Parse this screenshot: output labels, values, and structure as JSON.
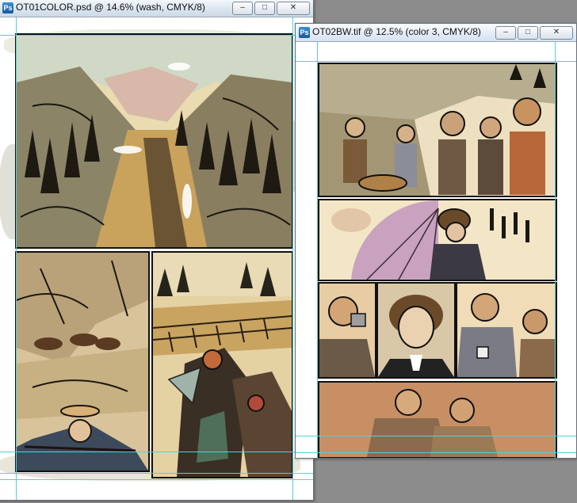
{
  "windows": [
    {
      "title": "OT01COLOR.psd @ 14.6% (wash, CMYK/8)",
      "buttons": {
        "minimize": "–",
        "maximize": "□",
        "close": "✕"
      },
      "icon": "Ps"
    },
    {
      "title": "OT02BW.tif @ 12.5% (color 3, CMYK/8)",
      "buttons": {
        "minimize": "–",
        "maximize": "□",
        "close": "✕"
      },
      "icon": "Ps"
    }
  ],
  "colors": {
    "guide": "#4fd3d8",
    "paper": "#f3e6c6",
    "ink": "#111111"
  }
}
